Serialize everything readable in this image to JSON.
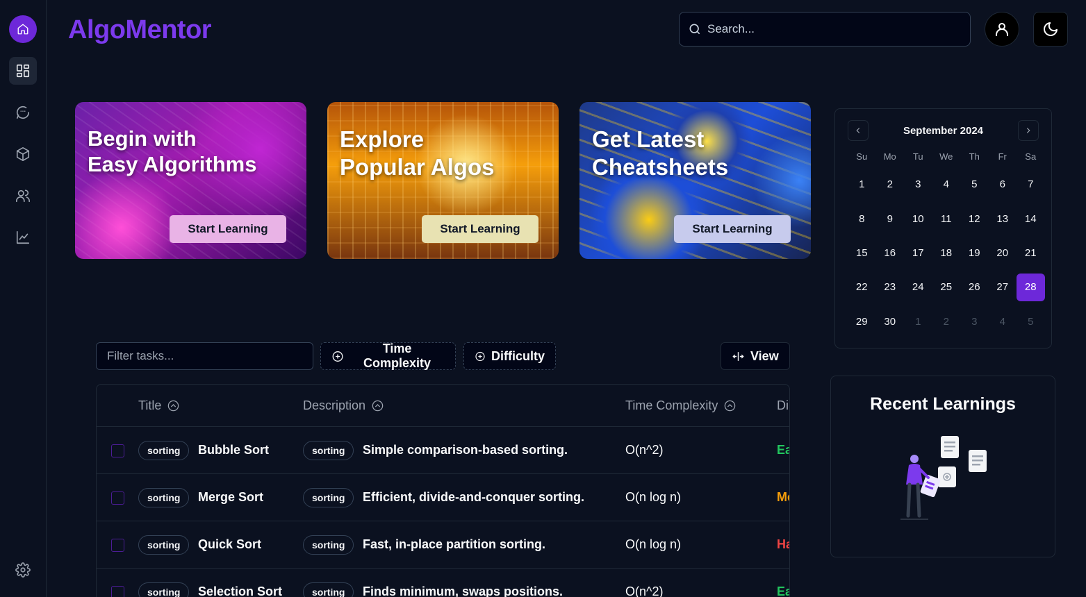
{
  "app": {
    "title": "AlgoMentor"
  },
  "header": {
    "search_placeholder": "Search..."
  },
  "hero_cards": [
    {
      "title_line1": "Begin with",
      "title_line2": "Easy Algorithms",
      "button": "Start Learning"
    },
    {
      "title_line1": "Explore",
      "title_line2": "Popular Algos",
      "button": "Start Learning"
    },
    {
      "title_line1": "Get Latest",
      "title_line2": "Cheatsheets",
      "button": "Start Learning"
    }
  ],
  "calendar": {
    "month": "September 2024",
    "weekdays": [
      "Su",
      "Mo",
      "Tu",
      "We",
      "Th",
      "Fr",
      "Sa"
    ],
    "days": [
      "1",
      "2",
      "3",
      "4",
      "5",
      "6",
      "7",
      "8",
      "9",
      "10",
      "11",
      "12",
      "13",
      "14",
      "15",
      "16",
      "17",
      "18",
      "19",
      "20",
      "21",
      "22",
      "23",
      "24",
      "25",
      "26",
      "27",
      "28",
      "29",
      "30",
      "1",
      "2",
      "3",
      "4",
      "5"
    ],
    "selected_day": "28",
    "accent_color": "#6d28d9"
  },
  "recent": {
    "title": "Recent Learnings"
  },
  "filters": {
    "filter_placeholder": "Filter tasks...",
    "time_complexity_label": "Time Complexity",
    "difficulty_label": "Difficulty",
    "view_label": "View"
  },
  "table": {
    "columns": {
      "title": "Title",
      "description": "Description",
      "time_complexity": "Time Complexity",
      "difficulty": "Di"
    },
    "rows": [
      {
        "tag": "sorting",
        "title": "Bubble Sort",
        "desc_tag": "sorting",
        "description": "Simple comparison-based sorting.",
        "complexity": "O(n^2)",
        "difficulty": "Ea",
        "difficulty_color": "#22c55e"
      },
      {
        "tag": "sorting",
        "title": "Merge Sort",
        "desc_tag": "sorting",
        "description": "Efficient, divide-and-conquer sorting.",
        "complexity": "O(n log n)",
        "difficulty": "Me",
        "difficulty_color": "#f59e0b"
      },
      {
        "tag": "sorting",
        "title": "Quick Sort",
        "desc_tag": "sorting",
        "description": "Fast, in-place partition sorting.",
        "complexity": "O(n log n)",
        "difficulty": "Ha",
        "difficulty_color": "#ef4444"
      },
      {
        "tag": "sorting",
        "title": "Selection Sort",
        "desc_tag": "sorting",
        "description": "Finds minimum, swaps positions.",
        "complexity": "O(n^2)",
        "difficulty": "Ea",
        "difficulty_color": "#22c55e"
      }
    ]
  }
}
